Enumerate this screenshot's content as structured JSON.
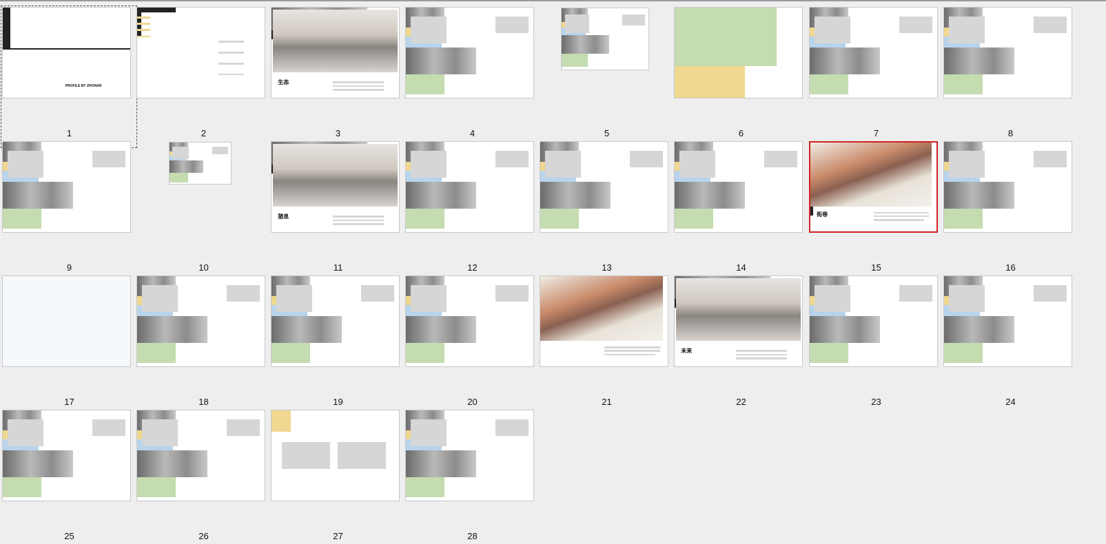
{
  "slide_sorter": {
    "slides": [
      {
        "num": "1",
        "text": "PROFILE BY ZHONAN"
      },
      {
        "num": "2"
      },
      {
        "num": "3",
        "text": "生态"
      },
      {
        "num": "4"
      },
      {
        "num": "5"
      },
      {
        "num": "6"
      },
      {
        "num": "7"
      },
      {
        "num": "8"
      },
      {
        "num": "9"
      },
      {
        "num": "10"
      },
      {
        "num": "11",
        "text": "憩息"
      },
      {
        "num": "12"
      },
      {
        "num": "13"
      },
      {
        "num": "14"
      },
      {
        "num": "15",
        "text": "街巷"
      },
      {
        "num": "16"
      },
      {
        "num": "17"
      },
      {
        "num": "18"
      },
      {
        "num": "19"
      },
      {
        "num": "20"
      },
      {
        "num": "21"
      },
      {
        "num": "22",
        "text": "未来"
      },
      {
        "num": "23"
      },
      {
        "num": "24"
      },
      {
        "num": "25"
      },
      {
        "num": "26"
      },
      {
        "num": "27"
      },
      {
        "num": "28"
      }
    ],
    "selected_slide": "15",
    "focused_slide": "1"
  },
  "colors": {
    "selection": "#d32020",
    "background": "#eeeeee",
    "thumb_bg": "#ffffff",
    "accent_blue": "#3a8fd0",
    "accent_yellow": "#e6b93a"
  }
}
